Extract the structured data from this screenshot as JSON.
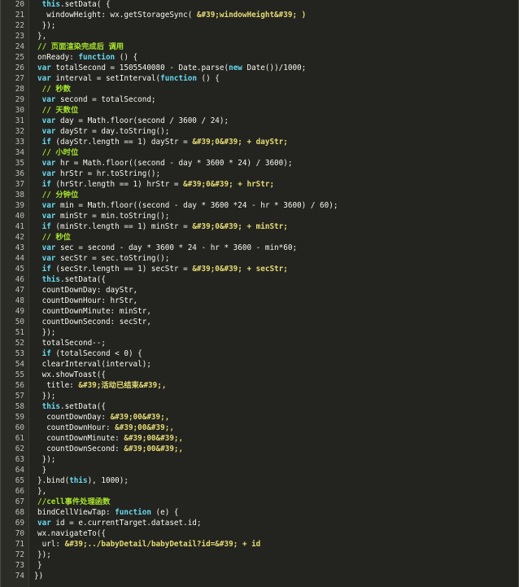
{
  "editor": {
    "colors": {
      "background": "#23241f",
      "gutter": "#2b2c26",
      "plain": "#f8f8f2",
      "keyword": "#66d9ef",
      "string": "#e6db74",
      "comment": "#a6e22e",
      "line_number": "#bfbfb8"
    },
    "lines": [
      {
        "n": "20",
        "indent": 2,
        "tokens": [
          {
            "t": "kw",
            "v": "this"
          },
          {
            "t": "plain",
            "v": ".setData( {"
          }
        ]
      },
      {
        "n": "21",
        "indent": 2,
        "tokens": [
          {
            "t": "plain",
            "v": " windowHeight: wx.getStorageSync( "
          },
          {
            "t": "str",
            "v": "&#39;windowHeight&#39; )"
          }
        ]
      },
      {
        "n": "22",
        "indent": 2,
        "tokens": [
          {
            "t": "plain",
            "v": "});"
          }
        ]
      },
      {
        "n": "23",
        "indent": 1,
        "tokens": [
          {
            "t": "plain",
            "v": "},"
          }
        ]
      },
      {
        "n": "24",
        "indent": 1,
        "tokens": [
          {
            "t": "cmt",
            "v": "// 页面渲染完成后 调用"
          }
        ]
      },
      {
        "n": "25",
        "indent": 1,
        "tokens": [
          {
            "t": "plain",
            "v": "onReady: "
          },
          {
            "t": "kw",
            "v": "function"
          },
          {
            "t": "plain",
            "v": " () {"
          }
        ]
      },
      {
        "n": "26",
        "indent": 1,
        "tokens": [
          {
            "t": "kw",
            "v": "var"
          },
          {
            "t": "plain",
            "v": " totalSecond = 1505540080 - Date.parse("
          },
          {
            "t": "kw",
            "v": "new"
          },
          {
            "t": "plain",
            "v": " Date())/1000;"
          }
        ]
      },
      {
        "n": "27",
        "indent": 1,
        "tokens": [
          {
            "t": "kw",
            "v": "var"
          },
          {
            "t": "plain",
            "v": " interval = setInterval("
          },
          {
            "t": "kw",
            "v": "function"
          },
          {
            "t": "plain",
            "v": " () {"
          }
        ]
      },
      {
        "n": "28",
        "indent": 2,
        "tokens": [
          {
            "t": "cmt",
            "v": "// 秒数"
          }
        ]
      },
      {
        "n": "29",
        "indent": 2,
        "tokens": [
          {
            "t": "kw",
            "v": "var"
          },
          {
            "t": "plain",
            "v": " second = totalSecond;"
          }
        ]
      },
      {
        "n": "30",
        "indent": 2,
        "tokens": [
          {
            "t": "cmt",
            "v": "// 天数位"
          }
        ]
      },
      {
        "n": "31",
        "indent": 2,
        "tokens": [
          {
            "t": "kw",
            "v": "var"
          },
          {
            "t": "plain",
            "v": " day = Math.floor(second / 3600 / 24);"
          }
        ]
      },
      {
        "n": "32",
        "indent": 2,
        "tokens": [
          {
            "t": "kw",
            "v": "var"
          },
          {
            "t": "plain",
            "v": " dayStr = day.toString();"
          }
        ]
      },
      {
        "n": "33",
        "indent": 2,
        "tokens": [
          {
            "t": "kw",
            "v": "if"
          },
          {
            "t": "plain",
            "v": " (dayStr.length == 1) dayStr = "
          },
          {
            "t": "str",
            "v": "&#39;0&#39; + dayStr;"
          }
        ]
      },
      {
        "n": "34",
        "indent": 2,
        "tokens": [
          {
            "t": "cmt",
            "v": "// 小时位"
          }
        ]
      },
      {
        "n": "35",
        "indent": 2,
        "tokens": [
          {
            "t": "kw",
            "v": "var"
          },
          {
            "t": "plain",
            "v": " hr = Math.floor((second - day * 3600 * 24) / 3600);"
          }
        ]
      },
      {
        "n": "36",
        "indent": 2,
        "tokens": [
          {
            "t": "kw",
            "v": "var"
          },
          {
            "t": "plain",
            "v": " hrStr = hr.toString();"
          }
        ]
      },
      {
        "n": "37",
        "indent": 2,
        "tokens": [
          {
            "t": "kw",
            "v": "if"
          },
          {
            "t": "plain",
            "v": " (hrStr.length == 1) hrStr = "
          },
          {
            "t": "str",
            "v": "&#39;0&#39; + hrStr;"
          }
        ]
      },
      {
        "n": "38",
        "indent": 2,
        "tokens": [
          {
            "t": "cmt",
            "v": "// 分钟位"
          }
        ]
      },
      {
        "n": "39",
        "indent": 2,
        "tokens": [
          {
            "t": "kw",
            "v": "var"
          },
          {
            "t": "plain",
            "v": " min = Math.floor((second - day * 3600 *24 - hr * 3600) / 60);"
          }
        ]
      },
      {
        "n": "40",
        "indent": 2,
        "tokens": [
          {
            "t": "kw",
            "v": "var"
          },
          {
            "t": "plain",
            "v": " minStr = min.toString();"
          }
        ]
      },
      {
        "n": "41",
        "indent": 2,
        "tokens": [
          {
            "t": "kw",
            "v": "if"
          },
          {
            "t": "plain",
            "v": " (minStr.length == 1) minStr = "
          },
          {
            "t": "str",
            "v": "&#39;0&#39; + minStr;"
          }
        ]
      },
      {
        "n": "42",
        "indent": 2,
        "tokens": [
          {
            "t": "cmt",
            "v": "// 秒位"
          }
        ]
      },
      {
        "n": "43",
        "indent": 2,
        "tokens": [
          {
            "t": "kw",
            "v": "var"
          },
          {
            "t": "plain",
            "v": " sec = second - day * 3600 * 24 - hr * 3600 - min*60;"
          }
        ]
      },
      {
        "n": "44",
        "indent": 2,
        "tokens": [
          {
            "t": "kw",
            "v": "var"
          },
          {
            "t": "plain",
            "v": " secStr = sec.toString();"
          }
        ]
      },
      {
        "n": "45",
        "indent": 2,
        "tokens": [
          {
            "t": "kw",
            "v": "if"
          },
          {
            "t": "plain",
            "v": " (secStr.length == 1) secStr = "
          },
          {
            "t": "str",
            "v": "&#39;0&#39; + secStr;"
          }
        ]
      },
      {
        "n": "46",
        "indent": 2,
        "tokens": [
          {
            "t": "kw",
            "v": "this"
          },
          {
            "t": "plain",
            "v": ".setData({"
          }
        ]
      },
      {
        "n": "47",
        "indent": 2,
        "tokens": [
          {
            "t": "plain",
            "v": "countDownDay: dayStr,"
          }
        ]
      },
      {
        "n": "48",
        "indent": 2,
        "tokens": [
          {
            "t": "plain",
            "v": "countDownHour: hrStr,"
          }
        ]
      },
      {
        "n": "49",
        "indent": 2,
        "tokens": [
          {
            "t": "plain",
            "v": "countDownMinute: minStr,"
          }
        ]
      },
      {
        "n": "50",
        "indent": 2,
        "tokens": [
          {
            "t": "plain",
            "v": "countDownSecond: secStr,"
          }
        ]
      },
      {
        "n": "51",
        "indent": 2,
        "tokens": [
          {
            "t": "plain",
            "v": "});"
          }
        ]
      },
      {
        "n": "52",
        "indent": 2,
        "tokens": [
          {
            "t": "plain",
            "v": "totalSecond--;"
          }
        ]
      },
      {
        "n": "53",
        "indent": 2,
        "tokens": [
          {
            "t": "kw",
            "v": "if"
          },
          {
            "t": "plain",
            "v": " (totalSecond < 0) {"
          }
        ]
      },
      {
        "n": "54",
        "indent": 2,
        "tokens": [
          {
            "t": "plain",
            "v": "clearInterval(interval);"
          }
        ]
      },
      {
        "n": "55",
        "indent": 2,
        "tokens": [
          {
            "t": "plain",
            "v": "wx.showToast({"
          }
        ]
      },
      {
        "n": "56",
        "indent": 3,
        "tokens": [
          {
            "t": "plain",
            "v": "title: "
          },
          {
            "t": "str",
            "v": "&#39;活动已结束&#39;,"
          }
        ]
      },
      {
        "n": "57",
        "indent": 2,
        "tokens": [
          {
            "t": "plain",
            "v": "});"
          }
        ]
      },
      {
        "n": "58",
        "indent": 2,
        "tokens": [
          {
            "t": "kw",
            "v": "this"
          },
          {
            "t": "plain",
            "v": ".setData({"
          }
        ]
      },
      {
        "n": "59",
        "indent": 3,
        "tokens": [
          {
            "t": "plain",
            "v": "countDownDay: "
          },
          {
            "t": "str",
            "v": "&#39;00&#39;,"
          }
        ]
      },
      {
        "n": "60",
        "indent": 3,
        "tokens": [
          {
            "t": "plain",
            "v": "countDownHour: "
          },
          {
            "t": "str",
            "v": "&#39;00&#39;,"
          }
        ]
      },
      {
        "n": "61",
        "indent": 3,
        "tokens": [
          {
            "t": "plain",
            "v": "countDownMinute: "
          },
          {
            "t": "str",
            "v": "&#39;00&#39;,"
          }
        ]
      },
      {
        "n": "62",
        "indent": 3,
        "tokens": [
          {
            "t": "plain",
            "v": "countDownSecond: "
          },
          {
            "t": "str",
            "v": "&#39;00&#39;,"
          }
        ]
      },
      {
        "n": "63",
        "indent": 2,
        "tokens": [
          {
            "t": "plain",
            "v": "});"
          }
        ]
      },
      {
        "n": "64",
        "indent": 2,
        "tokens": [
          {
            "t": "plain",
            "v": "}"
          }
        ]
      },
      {
        "n": "65",
        "indent": 1,
        "tokens": [
          {
            "t": "plain",
            "v": "}.bind("
          },
          {
            "t": "kw",
            "v": "this"
          },
          {
            "t": "plain",
            "v": "), 1000);"
          }
        ]
      },
      {
        "n": "66",
        "indent": 1,
        "tokens": [
          {
            "t": "plain",
            "v": "},"
          }
        ]
      },
      {
        "n": "67",
        "indent": 1,
        "tokens": [
          {
            "t": "cmt",
            "v": "//cell事件处理函数"
          }
        ]
      },
      {
        "n": "68",
        "indent": 1,
        "tokens": [
          {
            "t": "plain",
            "v": "bindCellViewTap: "
          },
          {
            "t": "kw",
            "v": "function"
          },
          {
            "t": "plain",
            "v": " (e) {"
          }
        ]
      },
      {
        "n": "69",
        "indent": 1,
        "tokens": [
          {
            "t": "kw",
            "v": "var"
          },
          {
            "t": "plain",
            "v": " id = e.currentTarget.dataset.id;"
          }
        ]
      },
      {
        "n": "70",
        "indent": 1,
        "tokens": [
          {
            "t": "plain",
            "v": "wx.navigateTo({"
          }
        ]
      },
      {
        "n": "71",
        "indent": 2,
        "tokens": [
          {
            "t": "plain",
            "v": "url: "
          },
          {
            "t": "str",
            "v": "&#39;../babyDetail/babyDetail?id=&#39; + id"
          }
        ]
      },
      {
        "n": "72",
        "indent": 1,
        "tokens": [
          {
            "t": "plain",
            "v": "});"
          }
        ]
      },
      {
        "n": "73",
        "indent": 1,
        "tokens": [
          {
            "t": "plain",
            "v": "}"
          }
        ]
      },
      {
        "n": "74",
        "indent": 0,
        "tokens": [
          {
            "t": "plain",
            "v": "})"
          }
        ]
      }
    ]
  }
}
